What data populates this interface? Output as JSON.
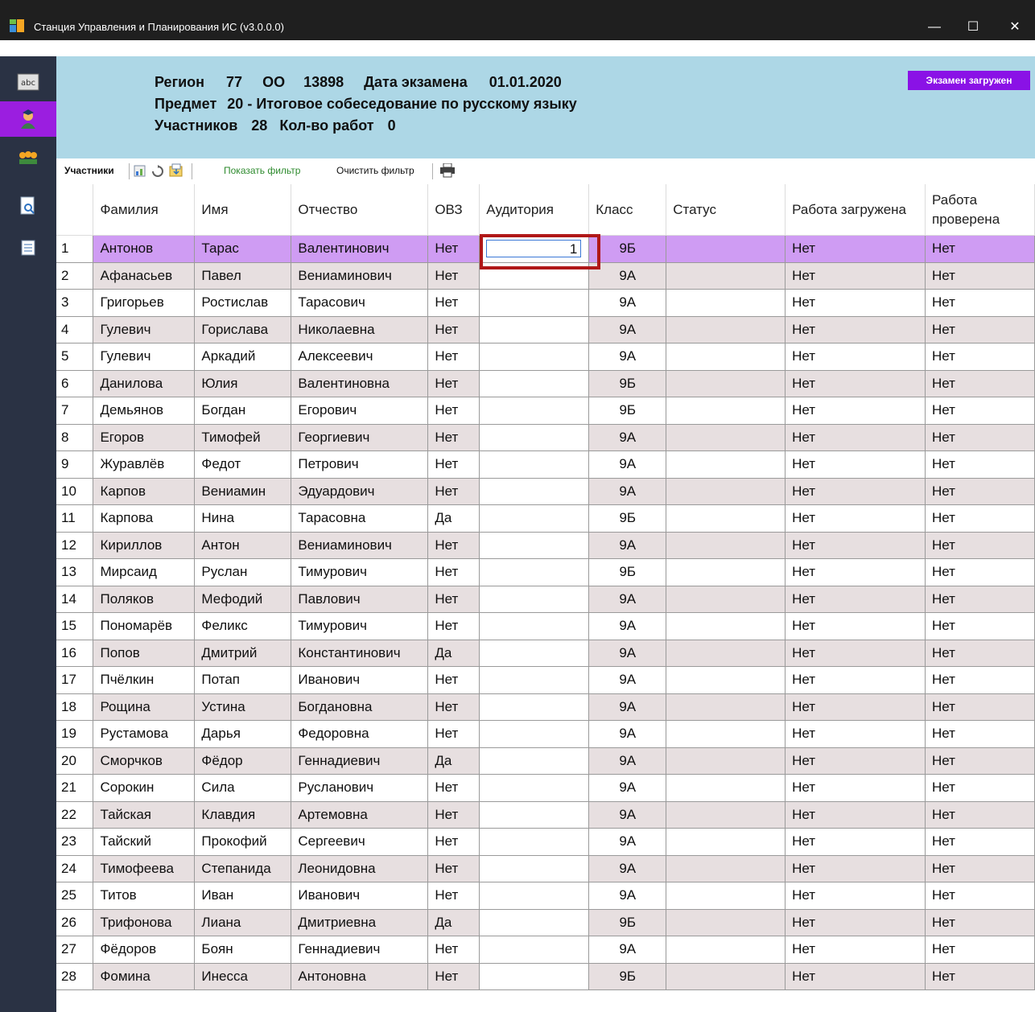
{
  "window": {
    "title": "Станция Управления и Планирования ИС (v3.0.0.0)",
    "controls": {
      "minimize": "—",
      "maximize": "☐",
      "close": "✕"
    }
  },
  "sidebar": {
    "items": [
      {
        "icon": "abc-icon",
        "label": "abc"
      },
      {
        "icon": "participant-icon",
        "active": true
      },
      {
        "icon": "group-icon"
      },
      {
        "icon": "document-search-icon"
      },
      {
        "icon": "list-icon"
      }
    ]
  },
  "header": {
    "region_label": "Регион",
    "region_value": "77",
    "oo_label": "ОО",
    "oo_value": "13898",
    "exam_date_label": "Дата экзамена",
    "exam_date_value": "01.01.2020",
    "subject_label": "Предмет",
    "subject_value": "20 - Итоговое собеседование по русскому языку",
    "participants_label": "Участников",
    "participants_value": "28",
    "works_label": "Кол-во работ",
    "works_value": "0",
    "status_badge": "Экзамен загружен",
    "status_color": "#8a12e6"
  },
  "toolbar": {
    "title": "Участники",
    "show_filter": "Показать фильтр",
    "clear_filter": "Очистить фильтр"
  },
  "table": {
    "columns": [
      "Фамилия",
      "Имя",
      "Отчество",
      "ОВЗ",
      "Аудитория",
      "Класс",
      "Статус",
      "Работа загружена",
      "Работа проверена"
    ],
    "selected_row": 1,
    "editing_value": "1",
    "rows": [
      [
        "1",
        "Антонов",
        "Тарас",
        "Валентинович",
        "Нет",
        "1",
        "9Б",
        "",
        "Нет",
        "Нет"
      ],
      [
        "2",
        "Афанасьев",
        "Павел",
        "Вениаминович",
        "Нет",
        "",
        "9А",
        "",
        "Нет",
        "Нет"
      ],
      [
        "3",
        "Григорьев",
        "Ростислав",
        "Тарасович",
        "Нет",
        "",
        "9А",
        "",
        "Нет",
        "Нет"
      ],
      [
        "4",
        "Гулевич",
        "Горислава",
        "Николаевна",
        "Нет",
        "",
        "9А",
        "",
        "Нет",
        "Нет"
      ],
      [
        "5",
        "Гулевич",
        "Аркадий",
        "Алексеевич",
        "Нет",
        "",
        "9А",
        "",
        "Нет",
        "Нет"
      ],
      [
        "6",
        "Данилова",
        "Юлия",
        "Валентиновна",
        "Нет",
        "",
        "9Б",
        "",
        "Нет",
        "Нет"
      ],
      [
        "7",
        "Демьянов",
        "Богдан",
        "Егорович",
        "Нет",
        "",
        "9Б",
        "",
        "Нет",
        "Нет"
      ],
      [
        "8",
        "Егоров",
        "Тимофей",
        "Георгиевич",
        "Нет",
        "",
        "9А",
        "",
        "Нет",
        "Нет"
      ],
      [
        "9",
        "Журавлёв",
        "Федот",
        "Петрович",
        "Нет",
        "",
        "9А",
        "",
        "Нет",
        "Нет"
      ],
      [
        "10",
        "Карпов",
        "Вениамин",
        "Эдуардович",
        "Нет",
        "",
        "9А",
        "",
        "Нет",
        "Нет"
      ],
      [
        "11",
        "Карпова",
        "Нина",
        "Тарасовна",
        "Да",
        "",
        "9Б",
        "",
        "Нет",
        "Нет"
      ],
      [
        "12",
        "Кириллов",
        "Антон",
        "Вениаминович",
        "Нет",
        "",
        "9А",
        "",
        "Нет",
        "Нет"
      ],
      [
        "13",
        "Мирсаид",
        "Руслан",
        "Тимурович",
        "Нет",
        "",
        "9Б",
        "",
        "Нет",
        "Нет"
      ],
      [
        "14",
        "Поляков",
        "Мефодий",
        "Павлович",
        "Нет",
        "",
        "9А",
        "",
        "Нет",
        "Нет"
      ],
      [
        "15",
        "Пономарёв",
        "Феликс",
        "Тимурович",
        "Нет",
        "",
        "9А",
        "",
        "Нет",
        "Нет"
      ],
      [
        "16",
        "Попов",
        "Дмитрий",
        "Константинович",
        "Да",
        "",
        "9А",
        "",
        "Нет",
        "Нет"
      ],
      [
        "17",
        "Пчёлкин",
        "Потап",
        "Иванович",
        "Нет",
        "",
        "9А",
        "",
        "Нет",
        "Нет"
      ],
      [
        "18",
        "Рощина",
        "Устина",
        "Богдановна",
        "Нет",
        "",
        "9А",
        "",
        "Нет",
        "Нет"
      ],
      [
        "19",
        "Рустамова",
        "Дарья",
        "Федоровна",
        "Нет",
        "",
        "9А",
        "",
        "Нет",
        "Нет"
      ],
      [
        "20",
        "Сморчков",
        "Фёдор",
        "Геннадиевич",
        "Да",
        "",
        "9А",
        "",
        "Нет",
        "Нет"
      ],
      [
        "21",
        "Сорокин",
        "Сила",
        "Русланович",
        "Нет",
        "",
        "9А",
        "",
        "Нет",
        "Нет"
      ],
      [
        "22",
        "Тайская",
        "Клавдия",
        "Артемовна",
        "Нет",
        "",
        "9А",
        "",
        "Нет",
        "Нет"
      ],
      [
        "23",
        "Тайский",
        "Прокофий",
        "Сергеевич",
        "Нет",
        "",
        "9А",
        "",
        "Нет",
        "Нет"
      ],
      [
        "24",
        "Тимофеева",
        "Степанида",
        "Леонидовна",
        "Нет",
        "",
        "9А",
        "",
        "Нет",
        "Нет"
      ],
      [
        "25",
        "Титов",
        "Иван",
        "Иванович",
        "Нет",
        "",
        "9А",
        "",
        "Нет",
        "Нет"
      ],
      [
        "26",
        "Трифонова",
        "Лиана",
        "Дмитриевна",
        "Да",
        "",
        "9Б",
        "",
        "Нет",
        "Нет"
      ],
      [
        "27",
        "Фёдоров",
        "Боян",
        "Геннадиевич",
        "Нет",
        "",
        "9А",
        "",
        "Нет",
        "Нет"
      ],
      [
        "28",
        "Фомина",
        "Инесса",
        "Антоновна",
        "Нет",
        "",
        "9Б",
        "",
        "Нет",
        "Нет"
      ]
    ]
  }
}
